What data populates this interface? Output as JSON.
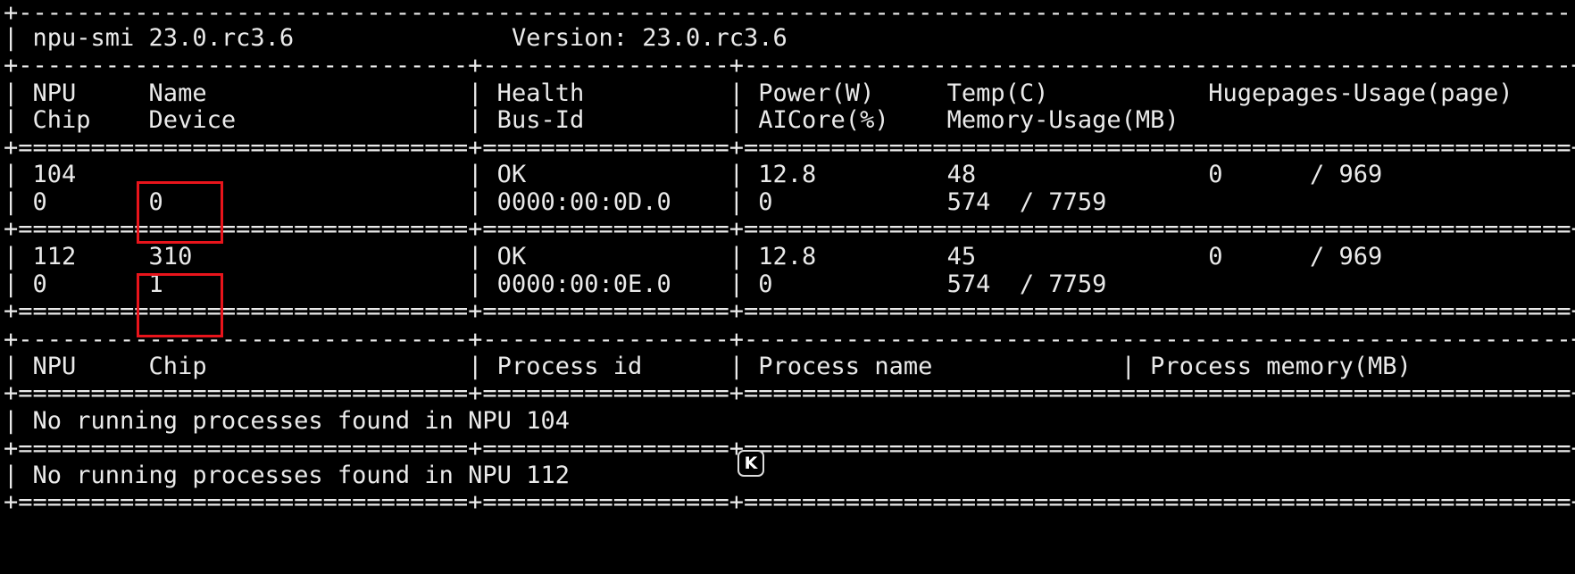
{
  "terminal": {
    "lines": [
      "+------------------------------------------------------------------------------------------------------------+",
      "| npu-smi 23.0.rc3.6               Version: 23.0.rc3.6                                                        |",
      "+-------------------------------+-----------------+---------------------------------------------------------+",
      "| NPU     Name                  | Health          | Power(W)     Temp(C)           Hugepages-Usage(page)    |",
      "| Chip    Device                | Bus-Id          | AICore(%)    Memory-Usage(MB)                           |",
      "+===============================+=================+=========================================================+",
      "| 104                           | OK              | 12.8         48                0      / 969             |",
      "| 0       0                     | 0000:00:0D.0    | 0            574  / 7759                                |",
      "+===============================+=================+=========================================================+",
      "| 112     310                   | OK              | 12.8         45                0      / 969             |",
      "| 0       1                     | 0000:00:0E.0    | 0            574  / 7759                                |",
      "+===============================+=================+=========================================================+",
      "+-------------------------------+-----------------+---------------------------------------------------------+",
      "| NPU     Chip                  | Process id      | Process name             | Process memory(MB)           |",
      "+===============================+=================+=========================================================+",
      "| No running processes found in NPU 104                                                                      |",
      "+===============================+=================+=========================================================+",
      "| No running processes found in NPU 112                                                                      |",
      "+===============================+=================+=========================================================+"
    ]
  },
  "overlay": {
    "badge_label": "K",
    "highlight_color": "#e8141b"
  }
}
